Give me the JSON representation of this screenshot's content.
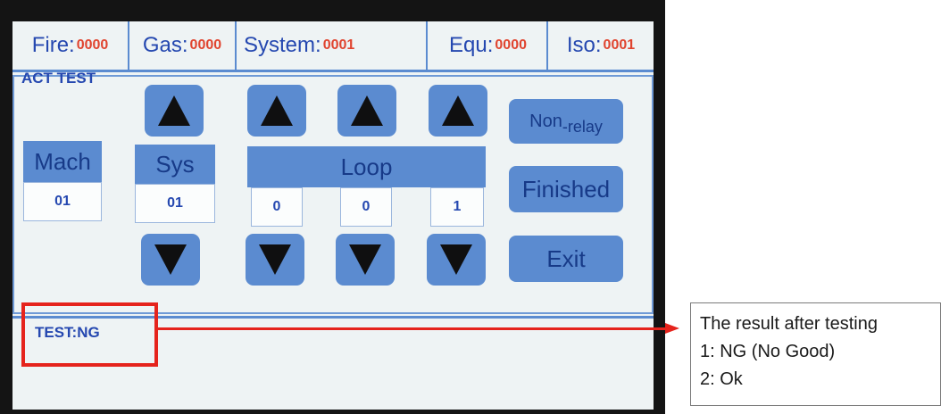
{
  "status": {
    "fire": {
      "label": "Fire:",
      "value": "0000"
    },
    "gas": {
      "label": "Gas:",
      "value": "0000"
    },
    "system": {
      "label": "System:",
      "value": "0001"
    },
    "equ": {
      "label": "Equ:",
      "value": "0000"
    },
    "iso": {
      "label": "Iso:",
      "value": "0001"
    }
  },
  "mode_title": "ACT TEST",
  "mach": {
    "label": "Mach",
    "value": "01"
  },
  "sys": {
    "label": "Sys",
    "value": "01"
  },
  "loop": {
    "label": "Loop",
    "digits": [
      "0",
      "0",
      "1"
    ]
  },
  "buttons": {
    "non_relay_main": "Non",
    "non_relay_sub": "-relay",
    "finished": "Finished",
    "exit": "Exit"
  },
  "result": "TEST:NG",
  "note": {
    "line1": "The result after testing",
    "line2": "1: NG (No Good)",
    "line3": "2: Ok"
  },
  "colors": {
    "accent": "#5b8bd0",
    "label_text": "#2548b0",
    "value_text": "#e0442f",
    "callout": "#e5231c"
  }
}
